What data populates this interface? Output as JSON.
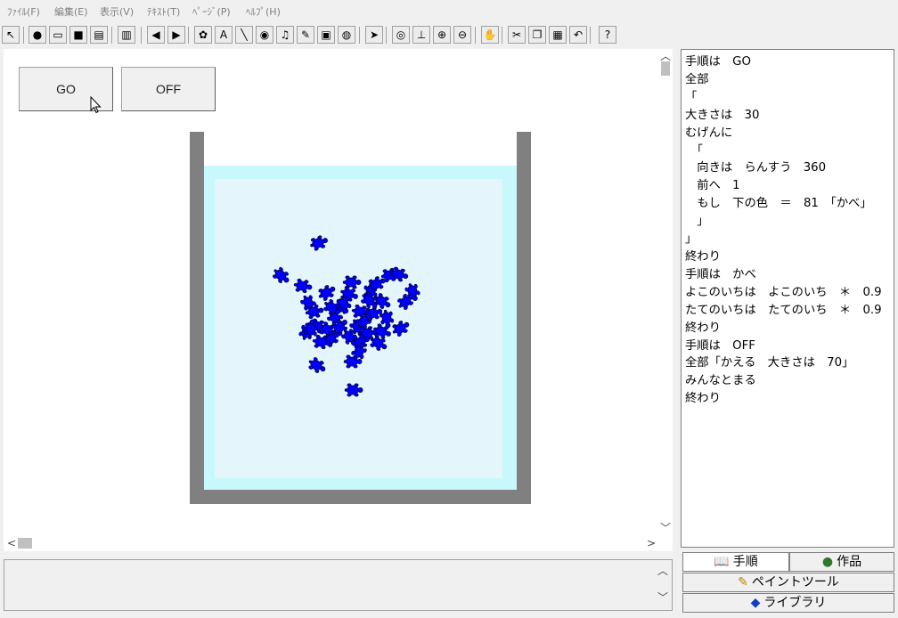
{
  "menu": [
    "ﾌｧｲﾙ(F)",
    "編集(E)",
    "表示(V)",
    "ﾃｷｽﾄ(T)",
    "ﾍﾟｰｼﾞ(P)",
    "ﾍﾙﾌﾟ(H)"
  ],
  "toolbar": [
    {
      "name": "select-cursor-icon",
      "glyph": "↖"
    },
    {
      "name": "globe-icon",
      "glyph": "●"
    },
    {
      "name": "open-folder-icon",
      "glyph": "▭"
    },
    {
      "name": "save-icon",
      "glyph": "■"
    },
    {
      "name": "print-icon",
      "glyph": "▤"
    },
    {
      "name": "layout-icon",
      "glyph": "▥"
    },
    {
      "name": "back-arrow-icon",
      "glyph": "◀"
    },
    {
      "name": "forward-arrow-icon",
      "glyph": "▶"
    },
    {
      "name": "turtle-icon",
      "glyph": "✿"
    },
    {
      "name": "text-icon",
      "glyph": "A"
    },
    {
      "name": "line-draw-icon",
      "glyph": "╲"
    },
    {
      "name": "capsule-icon",
      "glyph": "◉"
    },
    {
      "name": "music-note-icon",
      "glyph": "♫"
    },
    {
      "name": "pen-icon",
      "glyph": "✎"
    },
    {
      "name": "camera-icon",
      "glyph": "▣"
    },
    {
      "name": "database-icon",
      "glyph": "◍"
    },
    {
      "name": "pointer-icon",
      "glyph": "➤"
    },
    {
      "name": "eye-icon",
      "glyph": "◎"
    },
    {
      "name": "stamp-icon",
      "glyph": "⊥"
    },
    {
      "name": "zoom-in-icon",
      "glyph": "⊕"
    },
    {
      "name": "zoom-out-icon",
      "glyph": "⊖"
    },
    {
      "name": "stop-hand-icon",
      "glyph": "✋"
    },
    {
      "name": "cut-icon",
      "glyph": "✂"
    },
    {
      "name": "copy-icon",
      "glyph": "❐"
    },
    {
      "name": "paste-icon",
      "glyph": "▦"
    },
    {
      "name": "undo-icon",
      "glyph": "↶"
    },
    {
      "name": "help-icon",
      "glyph": "?"
    }
  ],
  "buttons": {
    "go": "GO",
    "off": "OFF"
  },
  "code_lines": [
    "手順は　GO",
    "全部",
    "「",
    "大きさは　30",
    "むげんに",
    "　「",
    "　向きは　らんすう　360",
    "　前へ　1",
    "　もし　下の色　＝　81　「かべ」",
    "　」",
    "」",
    "終わり",
    "手順は　かべ",
    "よこのいちは　よこのいち　＊　0.9",
    "たてのいちは　たてのいち　＊　0.9",
    "終わり",
    "手順は　OFF",
    "全部「かえる　大きさは　70」",
    "みんなとまる",
    "終わり"
  ],
  "tabs": {
    "procedure": "手順",
    "works": "作品",
    "paint": "ペイントツール",
    "library": "ライブラリ"
  },
  "colors": {
    "turtle": "#0000ff",
    "tank_wall": "#808080",
    "water_outer": "#c8f8fc",
    "water_inner": "#e4f6fc"
  },
  "turtles": [
    [
      357,
      273,
      -20
    ],
    [
      315,
      309,
      40
    ],
    [
      339,
      321,
      10
    ],
    [
      366,
      329,
      -30
    ],
    [
      346,
      340,
      60
    ],
    [
      394,
      317,
      0
    ],
    [
      416,
      327,
      90
    ],
    [
      437,
      309,
      -10
    ],
    [
      428,
      338,
      30
    ],
    [
      463,
      327,
      70
    ],
    [
      455,
      339,
      -40
    ],
    [
      391,
      330,
      20
    ],
    [
      384,
      344,
      -60
    ],
    [
      404,
      350,
      10
    ],
    [
      376,
      357,
      45
    ],
    [
      418,
      352,
      -15
    ],
    [
      434,
      357,
      80
    ],
    [
      449,
      369,
      -30
    ],
    [
      356,
      366,
      15
    ],
    [
      344,
      373,
      -70
    ],
    [
      367,
      370,
      25
    ],
    [
      381,
      368,
      -45
    ],
    [
      401,
      367,
      65
    ],
    [
      412,
      374,
      -5
    ],
    [
      424,
      385,
      30
    ],
    [
      404,
      384,
      -20
    ],
    [
      392,
      378,
      55
    ],
    [
      371,
      381,
      -35
    ],
    [
      360,
      384,
      10
    ],
    [
      349,
      370,
      -80
    ],
    [
      414,
      337,
      40
    ],
    [
      422,
      319,
      -25
    ],
    [
      447,
      308,
      15
    ],
    [
      395,
      406,
      0
    ],
    [
      355,
      410,
      30
    ],
    [
      396,
      438,
      0
    ],
    [
      386,
      341,
      75
    ],
    [
      408,
      361,
      -50
    ],
    [
      428,
      372,
      20
    ],
    [
      352,
      350,
      -10
    ],
    [
      372,
      345,
      35
    ],
    [
      403,
      395,
      -65
    ]
  ]
}
